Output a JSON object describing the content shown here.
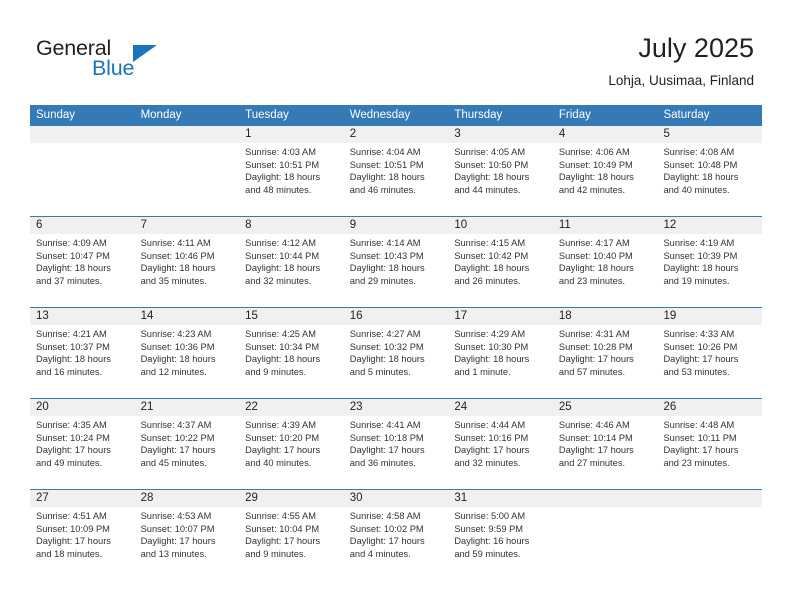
{
  "brand": {
    "name_part1": "General",
    "name_part2": "Blue",
    "accent_color": "#1b75bb",
    "triangle_icon": "triangle-icon"
  },
  "header": {
    "month_title": "July 2025",
    "location": "Lohja, Uusimaa, Finland"
  },
  "theme": {
    "header_blue": "#337ab7",
    "day_band_gray": "#f0f0f0",
    "text_color": "#231f20"
  },
  "weekdays": [
    "Sunday",
    "Monday",
    "Tuesday",
    "Wednesday",
    "Thursday",
    "Friday",
    "Saturday"
  ],
  "weeks": [
    [
      {
        "day": "",
        "sunrise": "",
        "sunset": "",
        "daylight_line1": "",
        "daylight_line2": ""
      },
      {
        "day": "",
        "sunrise": "",
        "sunset": "",
        "daylight_line1": "",
        "daylight_line2": ""
      },
      {
        "day": "1",
        "sunrise": "Sunrise: 4:03 AM",
        "sunset": "Sunset: 10:51 PM",
        "daylight_line1": "Daylight: 18 hours",
        "daylight_line2": "and 48 minutes."
      },
      {
        "day": "2",
        "sunrise": "Sunrise: 4:04 AM",
        "sunset": "Sunset: 10:51 PM",
        "daylight_line1": "Daylight: 18 hours",
        "daylight_line2": "and 46 minutes."
      },
      {
        "day": "3",
        "sunrise": "Sunrise: 4:05 AM",
        "sunset": "Sunset: 10:50 PM",
        "daylight_line1": "Daylight: 18 hours",
        "daylight_line2": "and 44 minutes."
      },
      {
        "day": "4",
        "sunrise": "Sunrise: 4:06 AM",
        "sunset": "Sunset: 10:49 PM",
        "daylight_line1": "Daylight: 18 hours",
        "daylight_line2": "and 42 minutes."
      },
      {
        "day": "5",
        "sunrise": "Sunrise: 4:08 AM",
        "sunset": "Sunset: 10:48 PM",
        "daylight_line1": "Daylight: 18 hours",
        "daylight_line2": "and 40 minutes."
      }
    ],
    [
      {
        "day": "6",
        "sunrise": "Sunrise: 4:09 AM",
        "sunset": "Sunset: 10:47 PM",
        "daylight_line1": "Daylight: 18 hours",
        "daylight_line2": "and 37 minutes."
      },
      {
        "day": "7",
        "sunrise": "Sunrise: 4:11 AM",
        "sunset": "Sunset: 10:46 PM",
        "daylight_line1": "Daylight: 18 hours",
        "daylight_line2": "and 35 minutes."
      },
      {
        "day": "8",
        "sunrise": "Sunrise: 4:12 AM",
        "sunset": "Sunset: 10:44 PM",
        "daylight_line1": "Daylight: 18 hours",
        "daylight_line2": "and 32 minutes."
      },
      {
        "day": "9",
        "sunrise": "Sunrise: 4:14 AM",
        "sunset": "Sunset: 10:43 PM",
        "daylight_line1": "Daylight: 18 hours",
        "daylight_line2": "and 29 minutes."
      },
      {
        "day": "10",
        "sunrise": "Sunrise: 4:15 AM",
        "sunset": "Sunset: 10:42 PM",
        "daylight_line1": "Daylight: 18 hours",
        "daylight_line2": "and 26 minutes."
      },
      {
        "day": "11",
        "sunrise": "Sunrise: 4:17 AM",
        "sunset": "Sunset: 10:40 PM",
        "daylight_line1": "Daylight: 18 hours",
        "daylight_line2": "and 23 minutes."
      },
      {
        "day": "12",
        "sunrise": "Sunrise: 4:19 AM",
        "sunset": "Sunset: 10:39 PM",
        "daylight_line1": "Daylight: 18 hours",
        "daylight_line2": "and 19 minutes."
      }
    ],
    [
      {
        "day": "13",
        "sunrise": "Sunrise: 4:21 AM",
        "sunset": "Sunset: 10:37 PM",
        "daylight_line1": "Daylight: 18 hours",
        "daylight_line2": "and 16 minutes."
      },
      {
        "day": "14",
        "sunrise": "Sunrise: 4:23 AM",
        "sunset": "Sunset: 10:36 PM",
        "daylight_line1": "Daylight: 18 hours",
        "daylight_line2": "and 12 minutes."
      },
      {
        "day": "15",
        "sunrise": "Sunrise: 4:25 AM",
        "sunset": "Sunset: 10:34 PM",
        "daylight_line1": "Daylight: 18 hours",
        "daylight_line2": "and 9 minutes."
      },
      {
        "day": "16",
        "sunrise": "Sunrise: 4:27 AM",
        "sunset": "Sunset: 10:32 PM",
        "daylight_line1": "Daylight: 18 hours",
        "daylight_line2": "and 5 minutes."
      },
      {
        "day": "17",
        "sunrise": "Sunrise: 4:29 AM",
        "sunset": "Sunset: 10:30 PM",
        "daylight_line1": "Daylight: 18 hours",
        "daylight_line2": "and 1 minute."
      },
      {
        "day": "18",
        "sunrise": "Sunrise: 4:31 AM",
        "sunset": "Sunset: 10:28 PM",
        "daylight_line1": "Daylight: 17 hours",
        "daylight_line2": "and 57 minutes."
      },
      {
        "day": "19",
        "sunrise": "Sunrise: 4:33 AM",
        "sunset": "Sunset: 10:26 PM",
        "daylight_line1": "Daylight: 17 hours",
        "daylight_line2": "and 53 minutes."
      }
    ],
    [
      {
        "day": "20",
        "sunrise": "Sunrise: 4:35 AM",
        "sunset": "Sunset: 10:24 PM",
        "daylight_line1": "Daylight: 17 hours",
        "daylight_line2": "and 49 minutes."
      },
      {
        "day": "21",
        "sunrise": "Sunrise: 4:37 AM",
        "sunset": "Sunset: 10:22 PM",
        "daylight_line1": "Daylight: 17 hours",
        "daylight_line2": "and 45 minutes."
      },
      {
        "day": "22",
        "sunrise": "Sunrise: 4:39 AM",
        "sunset": "Sunset: 10:20 PM",
        "daylight_line1": "Daylight: 17 hours",
        "daylight_line2": "and 40 minutes."
      },
      {
        "day": "23",
        "sunrise": "Sunrise: 4:41 AM",
        "sunset": "Sunset: 10:18 PM",
        "daylight_line1": "Daylight: 17 hours",
        "daylight_line2": "and 36 minutes."
      },
      {
        "day": "24",
        "sunrise": "Sunrise: 4:44 AM",
        "sunset": "Sunset: 10:16 PM",
        "daylight_line1": "Daylight: 17 hours",
        "daylight_line2": "and 32 minutes."
      },
      {
        "day": "25",
        "sunrise": "Sunrise: 4:46 AM",
        "sunset": "Sunset: 10:14 PM",
        "daylight_line1": "Daylight: 17 hours",
        "daylight_line2": "and 27 minutes."
      },
      {
        "day": "26",
        "sunrise": "Sunrise: 4:48 AM",
        "sunset": "Sunset: 10:11 PM",
        "daylight_line1": "Daylight: 17 hours",
        "daylight_line2": "and 23 minutes."
      }
    ],
    [
      {
        "day": "27",
        "sunrise": "Sunrise: 4:51 AM",
        "sunset": "Sunset: 10:09 PM",
        "daylight_line1": "Daylight: 17 hours",
        "daylight_line2": "and 18 minutes."
      },
      {
        "day": "28",
        "sunrise": "Sunrise: 4:53 AM",
        "sunset": "Sunset: 10:07 PM",
        "daylight_line1": "Daylight: 17 hours",
        "daylight_line2": "and 13 minutes."
      },
      {
        "day": "29",
        "sunrise": "Sunrise: 4:55 AM",
        "sunset": "Sunset: 10:04 PM",
        "daylight_line1": "Daylight: 17 hours",
        "daylight_line2": "and 9 minutes."
      },
      {
        "day": "30",
        "sunrise": "Sunrise: 4:58 AM",
        "sunset": "Sunset: 10:02 PM",
        "daylight_line1": "Daylight: 17 hours",
        "daylight_line2": "and 4 minutes."
      },
      {
        "day": "31",
        "sunrise": "Sunrise: 5:00 AM",
        "sunset": "Sunset: 9:59 PM",
        "daylight_line1": "Daylight: 16 hours",
        "daylight_line2": "and 59 minutes."
      },
      {
        "day": "",
        "sunrise": "",
        "sunset": "",
        "daylight_line1": "",
        "daylight_line2": ""
      },
      {
        "day": "",
        "sunrise": "",
        "sunset": "",
        "daylight_line1": "",
        "daylight_line2": ""
      }
    ]
  ]
}
